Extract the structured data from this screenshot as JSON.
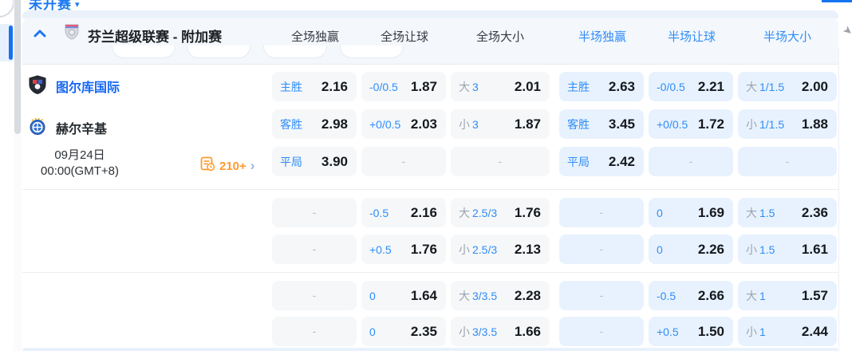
{
  "page": {
    "clipped_tab": "未开赛",
    "caret": "▾"
  },
  "header": {
    "league": "芬兰超级联赛 - 附加赛"
  },
  "odds": {
    "columns": [
      {
        "label": "全场独赢",
        "half": false
      },
      {
        "label": "全场让球",
        "half": false
      },
      {
        "label": "全场大小",
        "half": false
      },
      {
        "label": "半场独赢",
        "half": true
      },
      {
        "label": "半场让球",
        "half": true
      },
      {
        "label": "半场大小",
        "half": true
      }
    ],
    "groups": [
      [
        [
          {
            "l": "主胜",
            "v": "2.16"
          },
          {
            "l": "-0/0.5",
            "v": "1.87"
          },
          {
            "p": "大",
            "l": "3",
            "v": "2.01"
          },
          {
            "l": "主胜",
            "v": "2.63"
          },
          {
            "l": "-0/0.5",
            "v": "2.21"
          },
          {
            "p": "大",
            "l": "1/1.5",
            "v": "2.00"
          }
        ],
        [
          {
            "l": "客胜",
            "v": "2.98"
          },
          {
            "l": "+0/0.5",
            "v": "2.03"
          },
          {
            "p": "小",
            "l": "3",
            "v": "1.87"
          },
          {
            "l": "客胜",
            "v": "3.45"
          },
          {
            "l": "+0/0.5",
            "v": "1.72"
          },
          {
            "p": "小",
            "l": "1/1.5",
            "v": "1.88"
          }
        ],
        [
          {
            "l": "平局",
            "v": "3.90"
          },
          {
            "v": "-"
          },
          {
            "v": "-"
          },
          {
            "l": "平局",
            "v": "2.42"
          },
          {
            "v": "-"
          },
          {
            "v": "-"
          }
        ]
      ],
      [
        [
          {
            "v": "-"
          },
          {
            "l": "-0.5",
            "v": "2.16"
          },
          {
            "p": "大",
            "l": "2.5/3",
            "v": "1.76"
          },
          {
            "v": "-"
          },
          {
            "l": "0",
            "v": "1.69"
          },
          {
            "p": "大",
            "l": "1.5",
            "v": "2.36"
          }
        ],
        [
          {
            "v": "-"
          },
          {
            "l": "+0.5",
            "v": "1.76"
          },
          {
            "p": "小",
            "l": "2.5/3",
            "v": "2.13"
          },
          {
            "v": "-"
          },
          {
            "l": "0",
            "v": "2.26"
          },
          {
            "p": "小",
            "l": "1.5",
            "v": "1.61"
          }
        ]
      ],
      [
        [
          {
            "v": "-"
          },
          {
            "l": "0",
            "v": "1.64"
          },
          {
            "p": "大",
            "l": "3/3.5",
            "v": "2.28"
          },
          {
            "v": "-"
          },
          {
            "l": "-0.5",
            "v": "2.66"
          },
          {
            "p": "大",
            "l": "1",
            "v": "1.57"
          }
        ],
        [
          {
            "v": "-"
          },
          {
            "l": "0",
            "v": "2.35"
          },
          {
            "p": "小",
            "l": "3/3.5",
            "v": "1.66"
          },
          {
            "v": "-"
          },
          {
            "l": "+0.5",
            "v": "1.50"
          },
          {
            "p": "小",
            "l": "1",
            "v": "2.44"
          }
        ]
      ]
    ]
  },
  "match": {
    "home": "图尔库国际",
    "away": "赫尔辛基",
    "date": "09月24日",
    "time": "00:00(GMT+8)",
    "more_count": "210+",
    "more_chevron": "›"
  },
  "colors": {
    "accent_blue": "#1a78f0",
    "label_blue": "#2f8df8",
    "home_team_blue": "#1668f3",
    "fulltime_cell_bg": "#f5f7f9",
    "halftime_cell_bg": "#e8f2fe",
    "odds_value": "#15191e",
    "prefix_gray": "#9aa4ae",
    "orange": "#ff9a30"
  }
}
